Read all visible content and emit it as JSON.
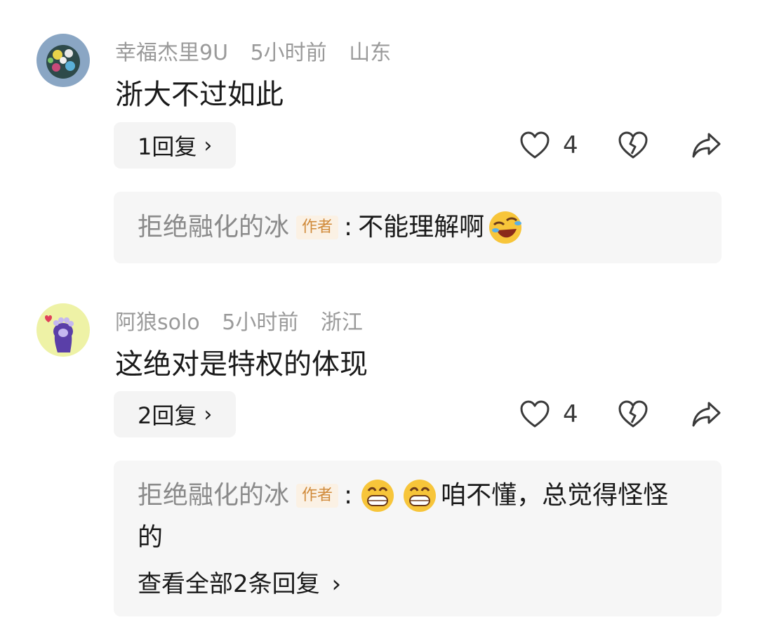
{
  "comments": [
    {
      "user": "幸福杰里9U",
      "time": "5小时前",
      "location": "山东",
      "text": "浙大不过如此",
      "reply_button": "1回复",
      "likes": "4",
      "sub_reply": {
        "author": "拒绝融化的冰",
        "badge": "作者",
        "colon": ":",
        "text": "不能理解啊",
        "emoji_before": [],
        "emoji_after": [
          "rolling-laugh-emoji"
        ]
      }
    },
    {
      "user": "阿狼solo",
      "time": "5小时前",
      "location": "浙江",
      "text": "这绝对是特权的体现",
      "reply_button": "2回复",
      "likes": "4",
      "sub_reply": {
        "author": "拒绝融化的冰",
        "badge": "作者",
        "colon": ":",
        "text": "咱不懂，总觉得怪怪",
        "text_cont": "的",
        "emoji_before": [
          "grin-emoji",
          "grin-emoji"
        ],
        "view_all": "查看全部2条回复"
      }
    }
  ],
  "icons": {
    "like": "heart-outline-icon",
    "dislike": "broken-heart-icon",
    "share": "share-arrow-icon",
    "chevron": "chevron-right-icon"
  },
  "chevron_glyph": "›"
}
